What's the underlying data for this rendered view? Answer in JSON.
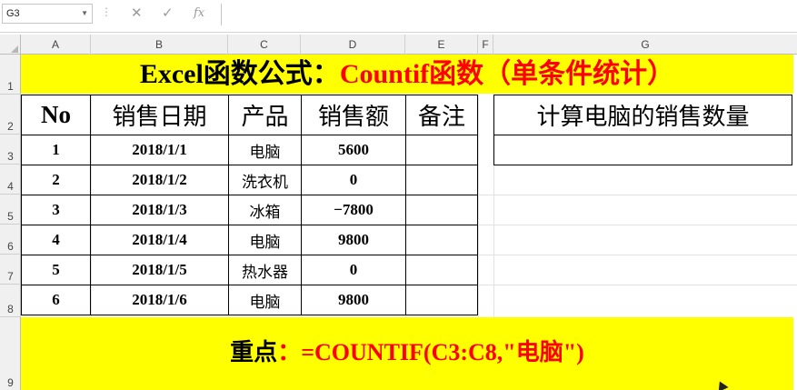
{
  "formula_bar": {
    "name_box": "G3",
    "cancel_icon": "✕",
    "enter_icon": "✓",
    "fx_label": "fx",
    "formula": ""
  },
  "columns": [
    "A",
    "B",
    "C",
    "D",
    "E",
    "F",
    "G"
  ],
  "rows": [
    "1",
    "2",
    "3",
    "4",
    "5",
    "6",
    "7",
    "8",
    "9"
  ],
  "sheet": {
    "title_black": "Excel函数公式：",
    "title_red": "Countif函数（单条件统计）",
    "table_headers": [
      "No",
      "销售日期",
      "产品",
      "销售额",
      "备注"
    ],
    "table_rows": [
      [
        "1",
        "2018/1/1",
        "电脑",
        "5600",
        ""
      ],
      [
        "2",
        "2018/1/2",
        "洗衣机",
        "0",
        ""
      ],
      [
        "3",
        "2018/1/3",
        "冰箱",
        "−7800",
        ""
      ],
      [
        "4",
        "2018/1/4",
        "电脑",
        "9800",
        ""
      ],
      [
        "5",
        "2018/1/5",
        "热水器",
        "0",
        ""
      ],
      [
        "6",
        "2018/1/6",
        "电脑",
        "9800",
        ""
      ]
    ],
    "question_header": "计算电脑的销售数量",
    "question_answer": "",
    "key_label": "重点",
    "key_colon": "：",
    "key_formula": "=COUNTIF(C3:C8,\"电脑\")"
  },
  "colors": {
    "banner": "#ffff00",
    "accent_red": "#ff0000",
    "header_bg": "#f0f0f0",
    "gridline": "#e2e2e2"
  }
}
